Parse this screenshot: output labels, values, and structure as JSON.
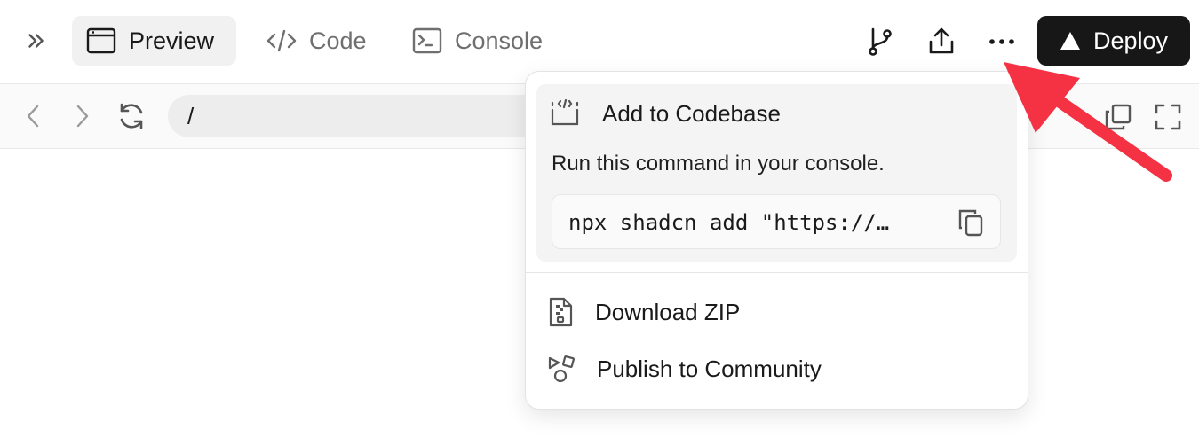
{
  "toolbar": {
    "tabs": [
      {
        "label": "Preview",
        "icon": "browser-window-icon",
        "active": true
      },
      {
        "label": "Code",
        "icon": "code-brackets-icon",
        "active": false
      },
      {
        "label": "Console",
        "icon": "terminal-icon",
        "active": false
      }
    ],
    "deploy_label": "Deploy",
    "right_icons": [
      "git-branch-icon",
      "share-upload-icon",
      "more-horizontal-icon"
    ]
  },
  "addressbar": {
    "url_value": "/",
    "icons": [
      "chevron-left-icon",
      "chevron-right-icon",
      "refresh-icon",
      "copy-icon",
      "fullscreen-icon"
    ]
  },
  "menu": {
    "codebase": {
      "title": "Add to Codebase",
      "description": "Run this command in your console.",
      "command": "npx shadcn add \"https://…"
    },
    "items": [
      {
        "label": "Download ZIP",
        "icon": "zip-file-icon"
      },
      {
        "label": "Publish to Community",
        "icon": "shapes-icon"
      }
    ]
  },
  "colors": {
    "deploy_bg": "#171717",
    "active_tab_bg": "#f1f1f1",
    "annotation_arrow": "#f43244"
  }
}
